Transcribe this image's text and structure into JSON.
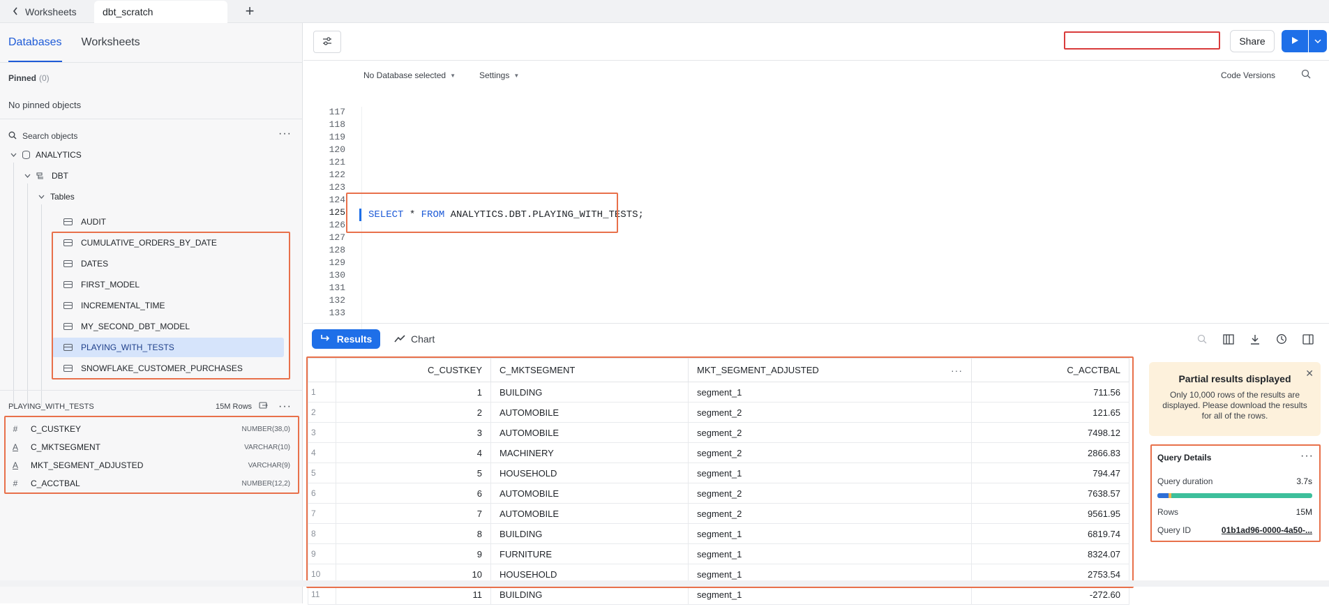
{
  "tabs": {
    "back_label": "Worksheets",
    "active_label": "dbt_scratch",
    "add_label": "+"
  },
  "sidebar": {
    "tabs": [
      "Databases",
      "Worksheets"
    ],
    "pinned_label": "Pinned",
    "pinned_count": "(0)",
    "no_pinned": "No pinned objects",
    "search_placeholder": "Search objects",
    "tree": {
      "database": "ANALYTICS",
      "schema": "DBT",
      "folder": "Tables",
      "tables": [
        "AUDIT",
        "CUMULATIVE_ORDERS_BY_DATE",
        "DATES",
        "FIRST_MODEL",
        "INCREMENTAL_TIME",
        "MY_SECOND_DBT_MODEL",
        "PLAYING_WITH_TESTS",
        "SNOWFLAKE_CUSTOMER_PURCHASES"
      ]
    },
    "detail": {
      "title": "PLAYING_WITH_TESTS",
      "rows": "15M Rows",
      "columns": [
        {
          "name": "C_CUSTKEY",
          "type": "NUMBER(38,0)",
          "icon": "#"
        },
        {
          "name": "C_MKTSEGMENT",
          "type": "VARCHAR(10)",
          "icon": "A"
        },
        {
          "name": "MKT_SEGMENT_ADJUSTED",
          "type": "VARCHAR(9)",
          "icon": "A"
        },
        {
          "name": "C_ACCTBAL",
          "type": "NUMBER(12,2)",
          "icon": "#"
        }
      ]
    }
  },
  "toolbar": {
    "share_label": "Share"
  },
  "editor": {
    "database_selector": "No Database selected",
    "settings_label": "Settings",
    "code_versions": "Code Versions",
    "line_numbers": [
      "117",
      "118",
      "119",
      "120",
      "121",
      "122",
      "123",
      "124",
      "125",
      "126",
      "127",
      "128",
      "129",
      "130",
      "131",
      "132",
      "133"
    ],
    "code": {
      "kw1": "SELECT",
      "star": " * ",
      "kw2": "FROM",
      "rest": " ANALYTICS.DBT.PLAYING_WITH_TESTS;"
    }
  },
  "results": {
    "results_label": "Results",
    "chart_label": "Chart",
    "columns": [
      "C_CUSTKEY",
      "C_MKTSEGMENT",
      "MKT_SEGMENT_ADJUSTED",
      "C_ACCTBAL"
    ],
    "rows": [
      [
        "1",
        "1",
        "BUILDING",
        "segment_1",
        "711.56"
      ],
      [
        "2",
        "2",
        "AUTOMOBILE",
        "segment_2",
        "121.65"
      ],
      [
        "3",
        "3",
        "AUTOMOBILE",
        "segment_2",
        "7498.12"
      ],
      [
        "4",
        "4",
        "MACHINERY",
        "segment_2",
        "2866.83"
      ],
      [
        "5",
        "5",
        "HOUSEHOLD",
        "segment_1",
        "794.47"
      ],
      [
        "6",
        "6",
        "AUTOMOBILE",
        "segment_2",
        "7638.57"
      ],
      [
        "7",
        "7",
        "AUTOMOBILE",
        "segment_2",
        "9561.95"
      ],
      [
        "8",
        "8",
        "BUILDING",
        "segment_1",
        "6819.74"
      ],
      [
        "9",
        "9",
        "FURNITURE",
        "segment_1",
        "8324.07"
      ],
      [
        "10",
        "10",
        "HOUSEHOLD",
        "segment_1",
        "2753.54"
      ],
      [
        "11",
        "11",
        "BUILDING",
        "segment_1",
        "-272.60"
      ]
    ]
  },
  "partial_results": {
    "title": "Partial results displayed",
    "text": "Only 10,000 rows of the results are displayed. Please download the results for all of the rows."
  },
  "query_details": {
    "title": "Query Details",
    "duration_label": "Query duration",
    "duration": "3.7s",
    "rows_label": "Rows",
    "rows": "15M",
    "id_label": "Query ID",
    "id": "01b1ad96-0000-4a50-..."
  },
  "colors": {
    "accent": "#1e6fe8",
    "highlight_box": "#e8704a",
    "title_box": "#d93b3b",
    "selected_row": "#d6e4fb"
  }
}
